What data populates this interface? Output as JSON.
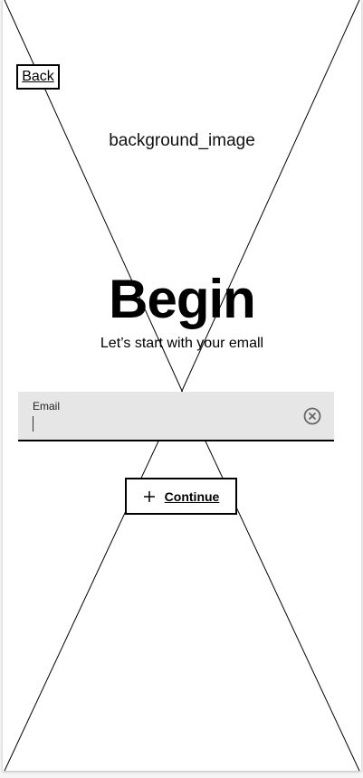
{
  "header": {
    "back_label": "Back"
  },
  "background": {
    "label": "background_image"
  },
  "main": {
    "title": "Begin",
    "subtitle": "Let’s start with your emall"
  },
  "form": {
    "email_label": "Email",
    "email_value": "",
    "clear_icon": "close-circle-icon"
  },
  "actions": {
    "continue_label": "Continue",
    "continue_icon": "plus-icon"
  }
}
